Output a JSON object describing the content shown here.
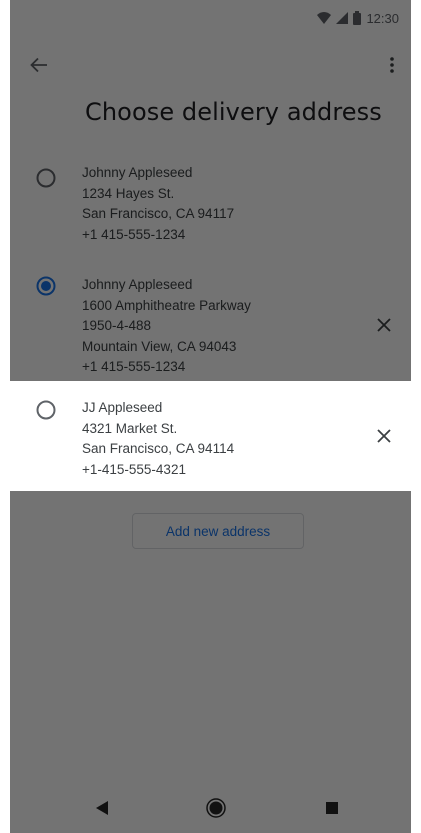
{
  "status_bar": {
    "time": "12:30",
    "icons": [
      "wifi-icon",
      "signal-icon",
      "battery-icon"
    ]
  },
  "app_bar": {
    "back_icon": "arrow-back-icon",
    "menu_icon": "more-vert-icon"
  },
  "page_title": "Choose delivery address",
  "addresses": [
    {
      "selected": false,
      "removable": false,
      "lines": [
        "Johnny Appleseed",
        "1234 Hayes St.",
        "San Francisco, CA 94117",
        "+1 415-555-1234"
      ]
    },
    {
      "selected": true,
      "removable": true,
      "lines": [
        "Johnny Appleseed",
        "1600 Amphitheatre Parkway",
        "1950-4-488",
        "Mountain View, CA 94043",
        "+1 415-555-1234"
      ]
    },
    {
      "selected": false,
      "removable": true,
      "highlighted": true,
      "lines": [
        "JJ Appleseed",
        "4321 Market St.",
        "San Francisco, CA 94114",
        "+1-415-555-4321"
      ]
    }
  ],
  "add_address_label": "Add new address",
  "colors": {
    "accent": "#1a73e8",
    "text": "#3c4043",
    "title": "#202124",
    "scrim": "rgba(0,0,0,0.55)"
  },
  "nav_bar": {
    "icons": [
      "nav-back-icon",
      "nav-home-icon",
      "nav-recents-icon"
    ]
  }
}
